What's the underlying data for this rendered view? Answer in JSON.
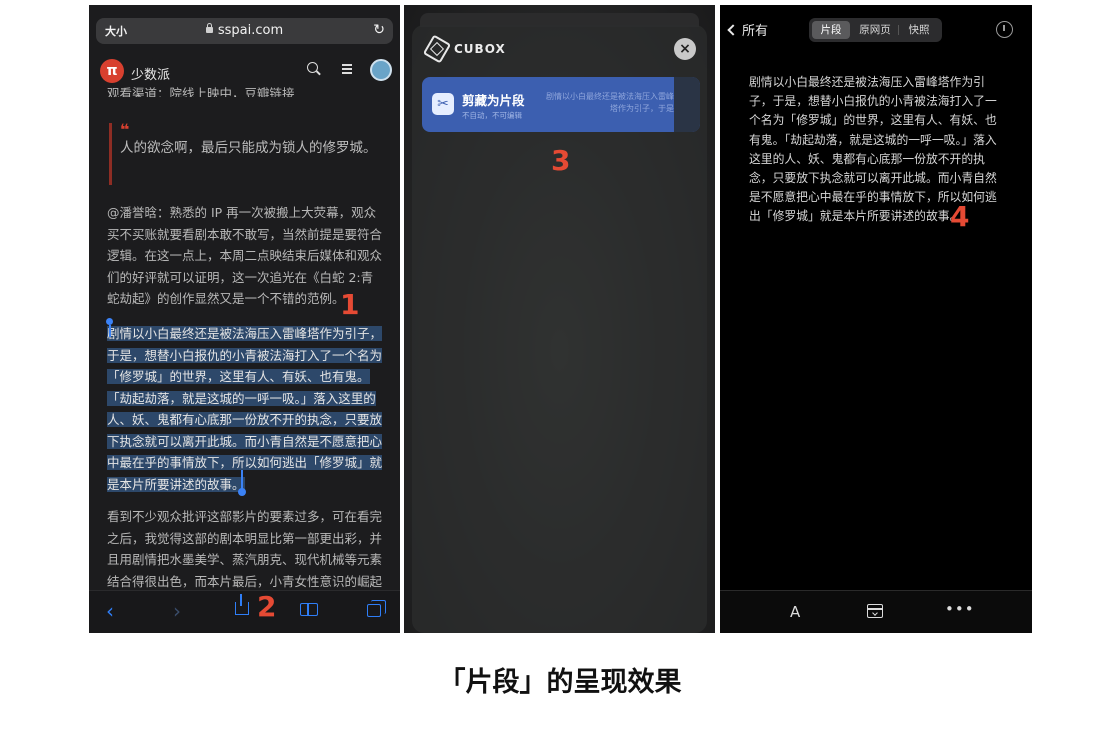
{
  "safari": {
    "text_size_label": "大小",
    "url": "sspai.com",
    "reload_icon": "reload-icon",
    "site_name": "少数派",
    "logo_glyph": "π",
    "partial_line": "观看渠道：院线上映中，豆瓣链接",
    "quote_mark": "❝",
    "quote_text": "人的欲念啊，最后只能成为锁人的修罗城。",
    "paragraph_1": "@潘誉晗：熟悉的 IP 再一次被搬上大荧幕，观众买不买账就要看剧本敢不敢写，当然前提是要符合逻辑。在这一点上，本周二点映结束后媒体和观众们的好评就可以证明，这一次追光在《白蛇 2:青蛇劫起》的创作显然又是一个不错的范例。",
    "selected_text": "剧情以小白最终还是被法海压入雷峰塔作为引子，于是，想替小白报仇的小青被法海打入了一个名为「修罗城」的世界，这里有人、有妖、也有鬼。「劫起劫落，就是这城的一呼一吸。」落入这里的人、妖、鬼都有心底那一份放不开的执念，只要放下执念就可以离开此城。而小青自然是不愿意把心中最在乎的事情放下，所以如何逃出「修罗城」就是本片所要讲述的故事。",
    "paragraph_3": "看到不少观众批评这部影片的要素过多，可在看完之后，我觉得这部的剧本明显比第一部更出彩，并且用剧情把水墨美学、蒸汽朋克、现代机械等元素结合得很出色，而本片最后，小青女性意识的崛起",
    "toolbar": {
      "back": "‹",
      "forward": "›"
    }
  },
  "steps": {
    "one": "1",
    "two": "2",
    "three": "3",
    "four": "4"
  },
  "cubox_sheet": {
    "brand": "CUBOX",
    "close_glyph": "×",
    "card_icon_glyph": "✂",
    "card_title": "剪藏为片段",
    "card_subtitle": "不自动，不可编辑",
    "card_desc": "剧情以小白最终还是被法海压入雷峰塔作为引子，于是"
  },
  "reader": {
    "back_label": "所有",
    "tabs": [
      "片段",
      "原网页",
      "快照"
    ],
    "active_tab": 0,
    "body": "剧情以小白最终还是被法海压入雷峰塔作为引子，于是，想替小白报仇的小青被法海打入了一个名为「修罗城」的世界，这里有人、有妖、也有鬼。「劫起劫落，就是这城的一呼一吸。」落入这里的人、妖、鬼都有心底那一份放不开的执念，只要放下执念就可以离开此城。而小青自然是不愿意把心中最在乎的事情放下，所以如何逃出「修罗城」就是本片所要讲述的故事。",
    "font_glyph": "A",
    "more_glyph": "•••"
  },
  "caption": "「片段」的呈现效果",
  "colors": {
    "accent_red": "#e54a34",
    "ios_blue": "#2f7ef7",
    "selection": "#3c6eaa",
    "cubox_card": "#3c5fb0"
  }
}
